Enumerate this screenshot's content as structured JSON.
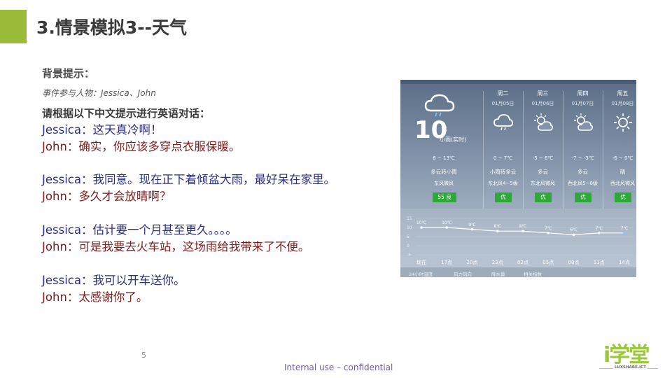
{
  "slide": {
    "title": "3.情景模拟3--天气",
    "background_heading": "背景提示：",
    "participants": "事件参与人物：Jessica、John",
    "instruction": "请根据以下中文提示进行英语对话：",
    "accent_color": "#9bbb3b"
  },
  "dialogue": [
    {
      "speaker": "Jessica",
      "text": "Jessica：这天真冷啊！"
    },
    {
      "speaker": "John",
      "text": "John：确实，你应该多穿点衣服保暖。"
    },
    {
      "speaker": "Jessica",
      "text": "Jessica：我同意。现在正下着倾盆大雨，最好呆在家里。"
    },
    {
      "speaker": "John",
      "text": "John：多久才会放晴啊？"
    },
    {
      "speaker": "Jessica",
      "text": "Jessica：估计要一个月甚至更久。。。。"
    },
    {
      "speaker": "John",
      "text": "John：可是我要去火车站，这场雨给我带来了不便。"
    },
    {
      "speaker": "Jessica",
      "text": "Jessica：我可以开车送你。"
    },
    {
      "speaker": "John",
      "text": "John：太感谢你了。"
    }
  ],
  "weather": {
    "today": {
      "icon": "cloud-rain-icon",
      "temp": "10",
      "unit": "℃",
      "condition": "小雨(实时)",
      "range": "6 ~ 13℃",
      "forecast": "多云转小雨",
      "wind": "东风微风",
      "aqi": "55 良"
    },
    "days": [
      {
        "weekday": "周二",
        "date": "01月05日",
        "icon": "cloud-rain-icon",
        "range": "0 ~ 7℃",
        "condition": "小雨转多云",
        "wind": "东北风4~5级",
        "aqi": "优"
      },
      {
        "weekday": "周三",
        "date": "01月06日",
        "icon": "partly-cloudy-icon",
        "range": "-5 ~ 6℃",
        "condition": "多云",
        "wind": "东北风微风",
        "aqi": "优"
      },
      {
        "weekday": "周四",
        "date": "01月07日",
        "icon": "partly-cloudy-icon",
        "range": "-7 ~ -3℃",
        "condition": "多云",
        "wind": "西北风5~6级",
        "aqi": "优"
      },
      {
        "weekday": "周五",
        "date": "01月08日",
        "icon": "sun-icon",
        "range": "-6 ~ 0℃",
        "condition": "晴",
        "wind": "西北风微风",
        "aqi": "优"
      }
    ],
    "hourly_chart": {
      "type": "line",
      "yticks": [
        "15",
        "10",
        "5",
        "0",
        "-5"
      ],
      "ylim": [
        -5,
        15
      ],
      "x": [
        "现在",
        "17点",
        "20点",
        "23点",
        "02点",
        "05点",
        "08点",
        "11点",
        "14点"
      ],
      "values": [
        10,
        10,
        9,
        8,
        8,
        7,
        6,
        7,
        7
      ],
      "labels": [
        "10℃",
        "10℃",
        "9℃",
        "8℃",
        "8℃",
        "7℃",
        "6℃",
        "7℃",
        "7℃"
      ]
    },
    "tabs": [
      "24小时温度",
      "风力风向",
      "降水量",
      "相关指数"
    ],
    "aqi_color": "#2fa83a"
  },
  "footer": {
    "page_number": "5",
    "note": "Internal use – confidential",
    "logo_text": "i学堂",
    "logo_sub": "LUXSHARE-ICT"
  }
}
